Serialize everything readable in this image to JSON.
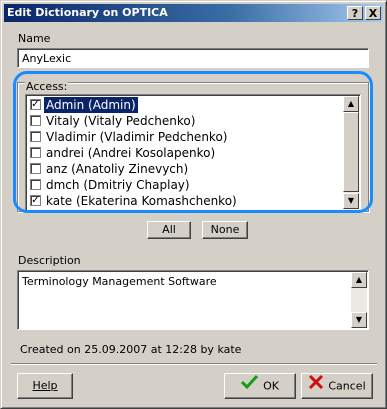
{
  "window": {
    "title": "Edit Dictionary on OPTICA",
    "help_btn": "?",
    "close_btn": "X"
  },
  "name": {
    "label": "Name",
    "value": "AnyLexic"
  },
  "access": {
    "label": "Access:",
    "users": [
      {
        "label": "Admin (Admin)",
        "checked": true,
        "selected": true
      },
      {
        "label": "Vitaly (Vitaly Pedchenko)",
        "checked": false,
        "selected": false
      },
      {
        "label": "Vladimir (Vladimir Pedchenko)",
        "checked": false,
        "selected": false
      },
      {
        "label": "andrei (Andrei Kosolapenko)",
        "checked": false,
        "selected": false
      },
      {
        "label": "anz (Anatoliy Zinevych)",
        "checked": false,
        "selected": false
      },
      {
        "label": "dmch (Dmitriy Chaplay)",
        "checked": false,
        "selected": false
      },
      {
        "label": "kate (Ekaterina Komashchenko)",
        "checked": true,
        "selected": false
      }
    ],
    "all_label": "All",
    "none_label": "None"
  },
  "description": {
    "label": "Description",
    "value": "Terminology Management Software"
  },
  "created_text": "Created on 25.09.2007 at 12:28  by kate",
  "buttons": {
    "help": "Help",
    "ok": "OK",
    "cancel": "Cancel"
  },
  "colors": {
    "title_start": "#0a246a",
    "selection": "#0a246a",
    "highlight_ring": "#1a8cff"
  }
}
